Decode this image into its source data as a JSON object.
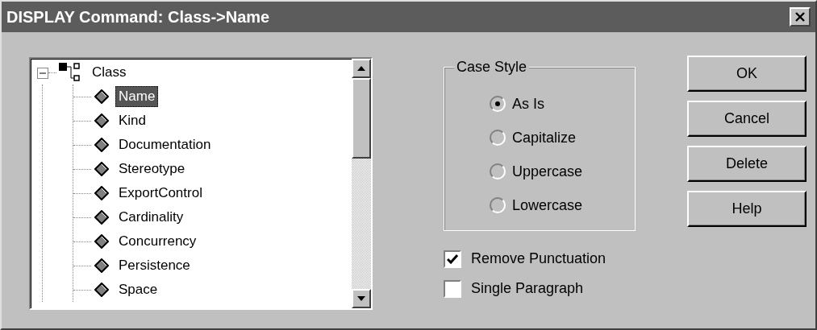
{
  "window": {
    "title": "DISPLAY Command: Class->Name"
  },
  "tree": [
    {
      "label": "Class",
      "kind": "class",
      "expanded": true,
      "selected": false,
      "children": [
        {
          "label": "Name",
          "kind": "attribute",
          "selected": true
        },
        {
          "label": "Kind",
          "kind": "attribute",
          "selected": false
        },
        {
          "label": "Documentation",
          "kind": "attribute",
          "selected": false
        },
        {
          "label": "Stereotype",
          "kind": "attribute",
          "selected": false
        },
        {
          "label": "ExportControl",
          "kind": "attribute",
          "selected": false
        },
        {
          "label": "Cardinality",
          "kind": "attribute",
          "selected": false
        },
        {
          "label": "Concurrency",
          "kind": "attribute",
          "selected": false
        },
        {
          "label": "Persistence",
          "kind": "attribute",
          "selected": false
        },
        {
          "label": "Space",
          "kind": "attribute",
          "selected": false
        }
      ]
    }
  ],
  "case_style": {
    "title": "Case Style",
    "options": [
      {
        "label": "As Is",
        "selected": true
      },
      {
        "label": "Capitalize",
        "selected": false
      },
      {
        "label": "Uppercase",
        "selected": false
      },
      {
        "label": "Lowercase",
        "selected": false
      }
    ]
  },
  "checkboxes": [
    {
      "label": "Remove Punctuation",
      "checked": true
    },
    {
      "label": "Single Paragraph",
      "checked": false
    }
  ],
  "buttons": [
    {
      "label": "OK"
    },
    {
      "label": "Cancel"
    },
    {
      "label": "Delete"
    },
    {
      "label": "Help"
    }
  ]
}
